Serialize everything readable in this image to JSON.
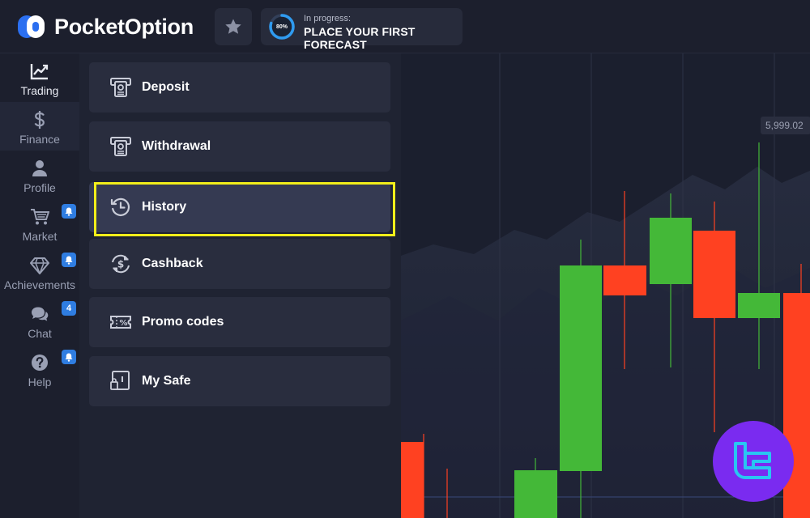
{
  "app": {
    "logo_text": "PocketOption",
    "progress": {
      "percent_label": "80%",
      "percent_value": 80,
      "status": "In progress:",
      "title": "PLACE YOUR FIRST FORECAST"
    }
  },
  "sidebar": {
    "items": [
      {
        "label": "Trading",
        "icon": "trend-chart-icon"
      },
      {
        "label": "Finance",
        "icon": "dollar-icon"
      },
      {
        "label": "Profile",
        "icon": "user-icon"
      },
      {
        "label": "Market",
        "icon": "cart-icon",
        "badge": "bell"
      },
      {
        "label": "Achievements",
        "icon": "diamond-icon",
        "badge": "bell"
      },
      {
        "label": "Chat",
        "icon": "chat-icon",
        "badge": "4"
      },
      {
        "label": "Help",
        "icon": "question-icon",
        "badge": "bell"
      }
    ]
  },
  "finance_menu": {
    "items": [
      {
        "label": "Deposit",
        "icon": "atm-deposit-icon"
      },
      {
        "label": "Withdrawal",
        "icon": "atm-withdraw-icon"
      },
      {
        "label": "History",
        "icon": "history-icon"
      },
      {
        "label": "Cashback",
        "icon": "cashback-icon"
      },
      {
        "label": "Promo codes",
        "icon": "promo-ticket-icon"
      },
      {
        "label": "My Safe",
        "icon": "safe-icon"
      }
    ],
    "selected": "History"
  },
  "chart": {
    "price_label": "5,999.02"
  },
  "colors": {
    "bull": "#44b838",
    "bear": "#ff4121",
    "accent": "#2f7de1",
    "highlight": "#f2ee1a",
    "watermark": "#7a2bf0"
  }
}
